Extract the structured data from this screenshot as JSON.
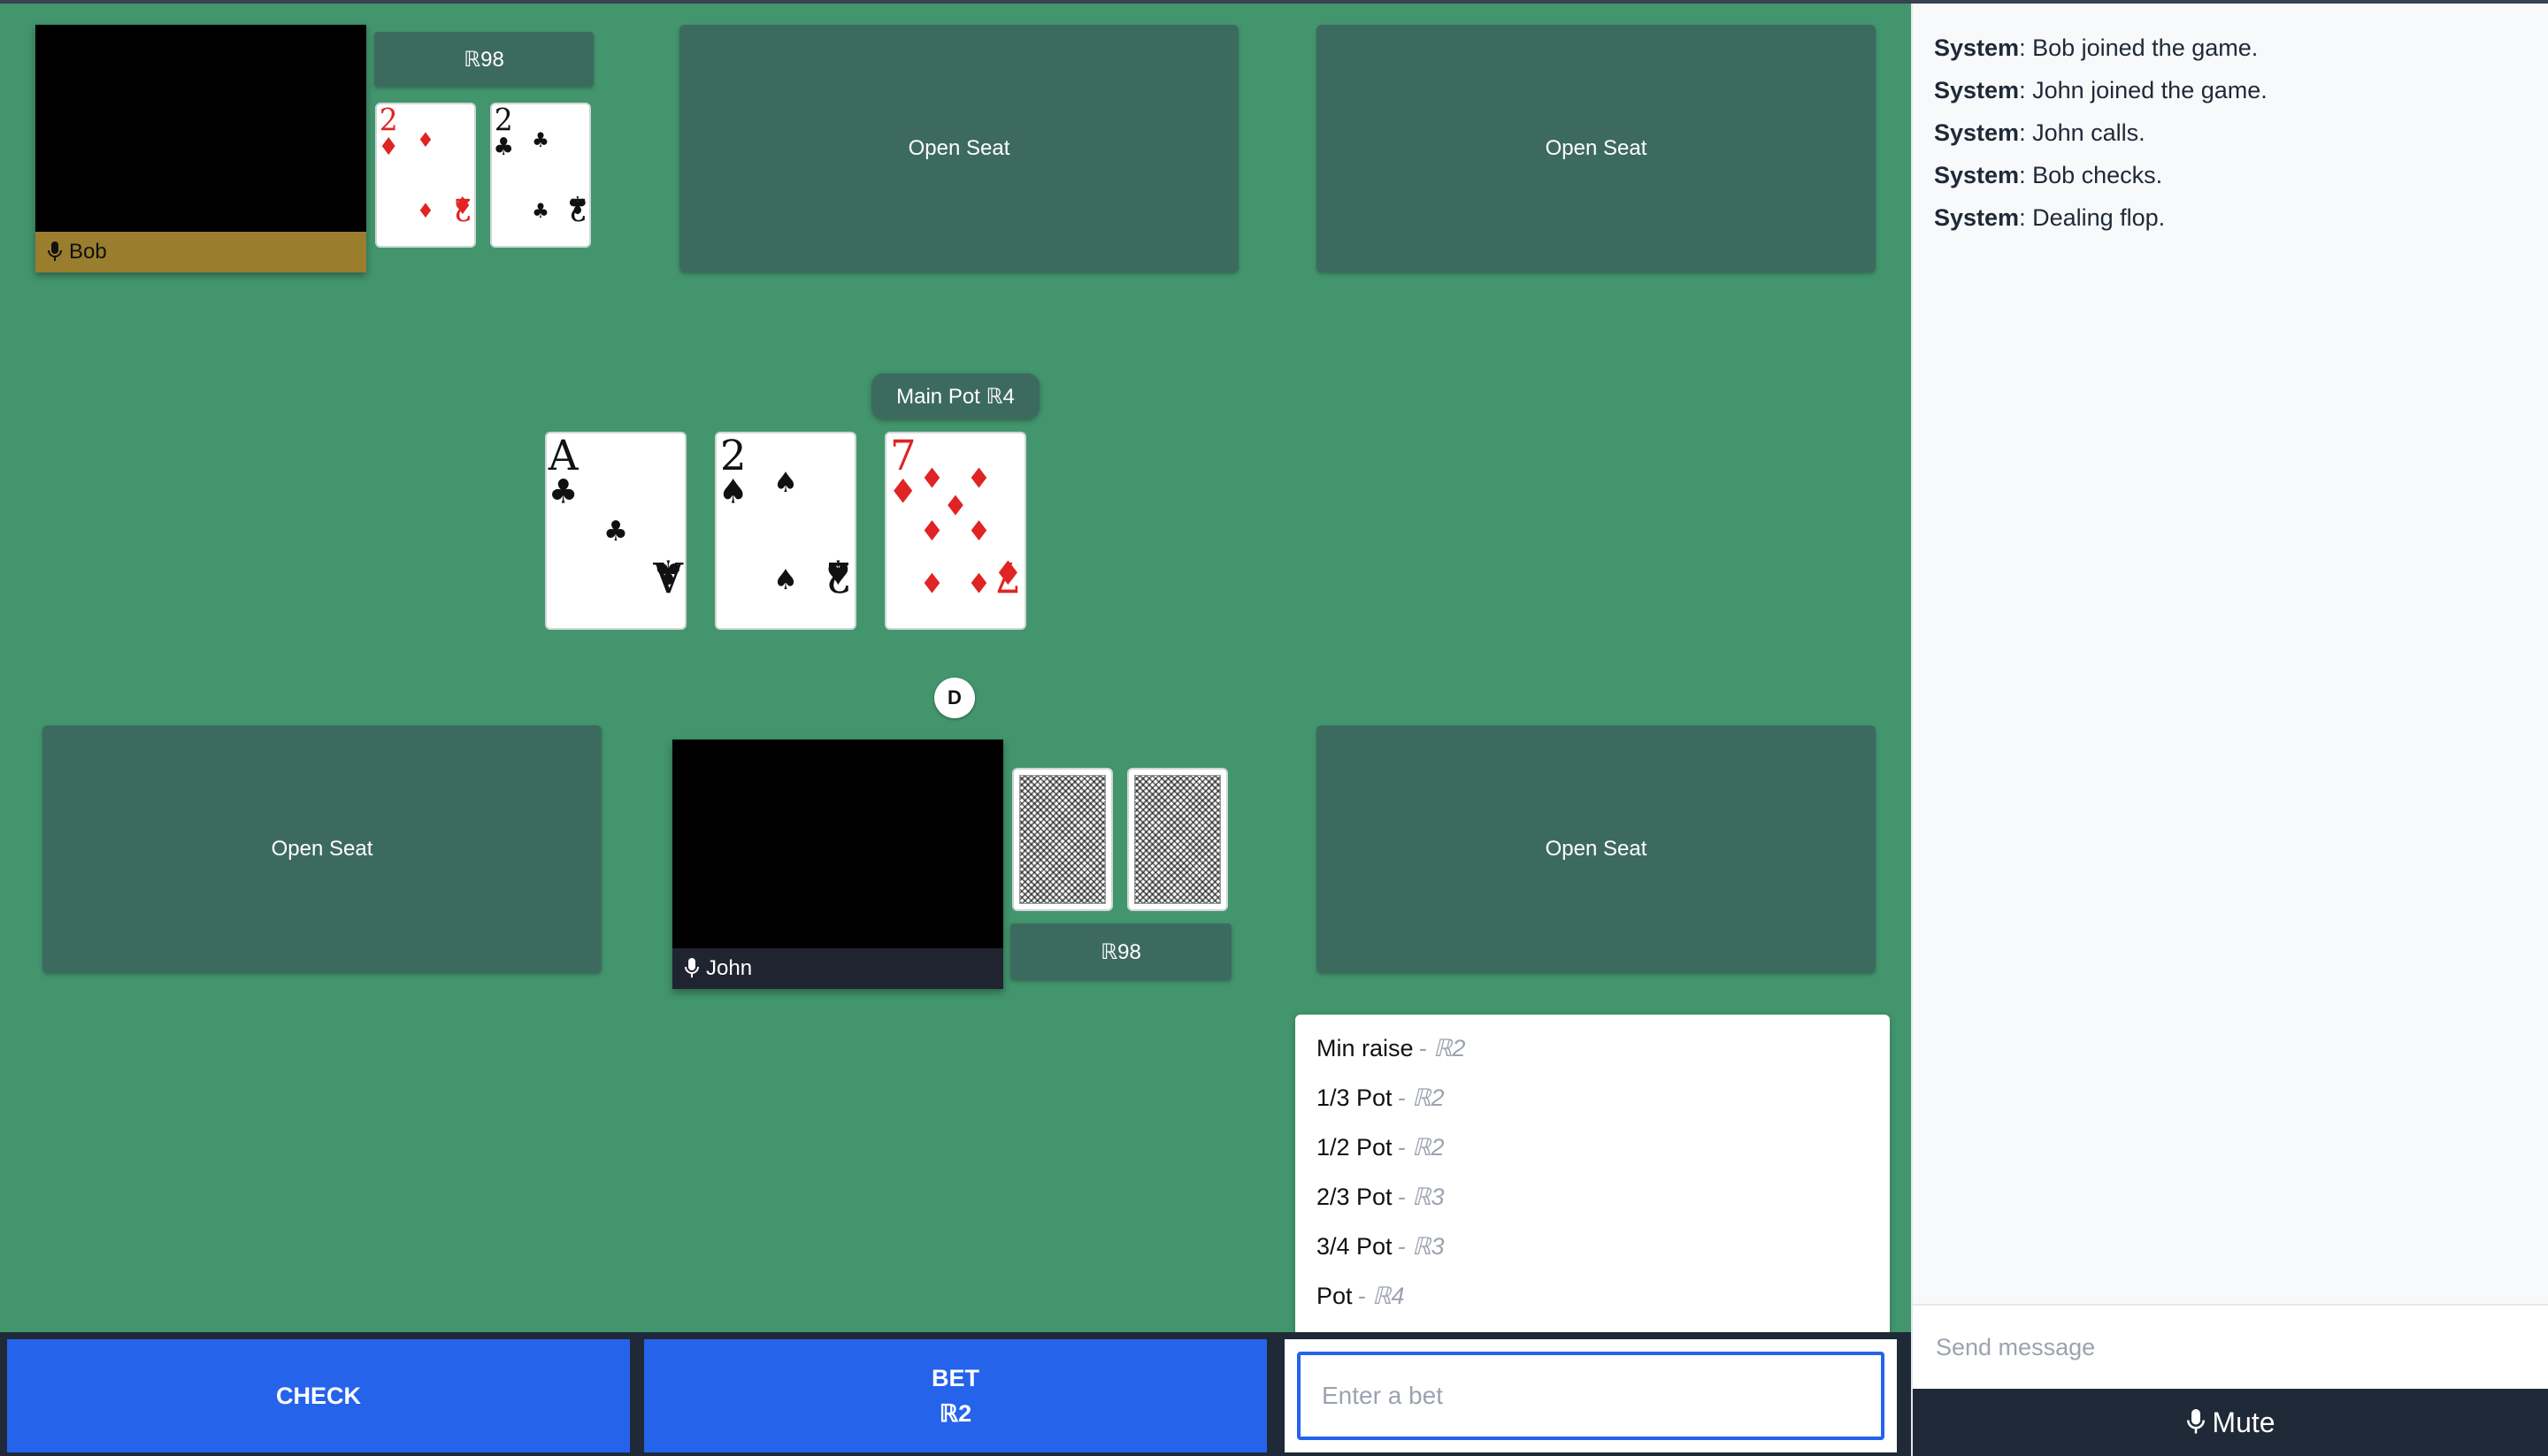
{
  "table": {
    "open_seat_label": "Open Seat",
    "seats": [
      {
        "player": "Bob",
        "stack": "ℝ98",
        "cards": [
          {
            "rank": "2",
            "suit": "diamonds"
          },
          {
            "rank": "2",
            "suit": "clubs"
          }
        ]
      },
      {
        "player": "John",
        "stack": "ℝ98",
        "cards": [
          "back",
          "back"
        ]
      }
    ],
    "pot": "Main Pot ℝ4",
    "dealer_button": "D",
    "board": [
      {
        "rank": "A",
        "suit": "clubs"
      },
      {
        "rank": "2",
        "suit": "spades"
      },
      {
        "rank": "7",
        "suit": "diamonds"
      }
    ]
  },
  "bet_menu": [
    {
      "label": "Min raise",
      "amount": "- ℝ2"
    },
    {
      "label": "1/3 Pot",
      "amount": "- ℝ2"
    },
    {
      "label": "1/2 Pot",
      "amount": "- ℝ2"
    },
    {
      "label": "2/3 Pot",
      "amount": "- ℝ3"
    },
    {
      "label": "3/4 Pot",
      "amount": "- ℝ3"
    },
    {
      "label": "Pot",
      "amount": "- ℝ4"
    }
  ],
  "actions": {
    "check_label": "CHECK",
    "bet_label": "BET",
    "bet_amount": "ℝ2",
    "bet_input_placeholder": "Enter a bet"
  },
  "chat": {
    "messages": [
      {
        "sender": "System",
        "text": ": Bob joined the game."
      },
      {
        "sender": "System",
        "text": ": John joined the game."
      },
      {
        "sender": "System",
        "text": ": John calls."
      },
      {
        "sender": "System",
        "text": ": Bob checks."
      },
      {
        "sender": "System",
        "text": ": Dealing flop."
      }
    ],
    "input_placeholder": "Send message",
    "mute_label": "Mute"
  },
  "colors": {
    "felt": "#42956d",
    "seat": "#3d6a5f",
    "active_player": "#9b7d2e",
    "button": "#2563eb",
    "red_suit": "#e02424"
  },
  "icons": {
    "mic": "microphone-icon"
  }
}
